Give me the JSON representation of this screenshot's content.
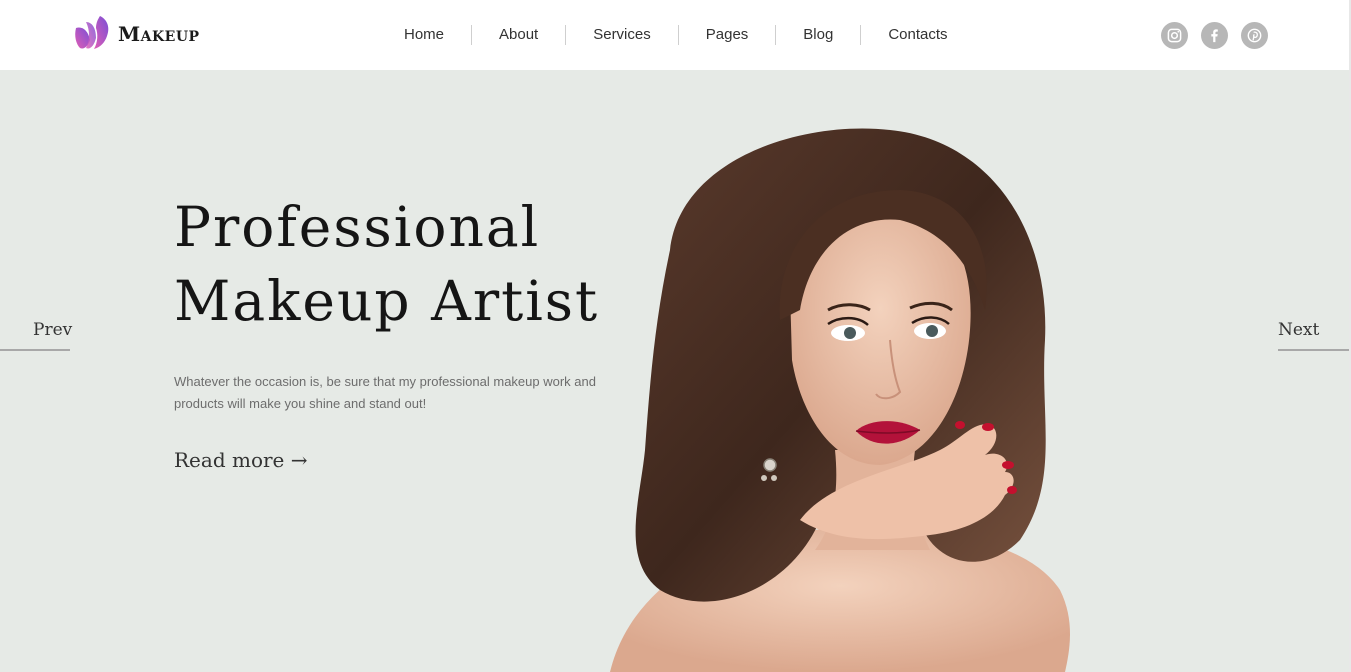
{
  "brand": {
    "name": "Makeup",
    "icon": "butterfly-face-logo"
  },
  "nav": {
    "items": [
      {
        "label": "Home"
      },
      {
        "label": "About"
      },
      {
        "label": "Services"
      },
      {
        "label": "Pages"
      },
      {
        "label": "Blog"
      },
      {
        "label": "Contacts"
      }
    ]
  },
  "social": [
    {
      "icon": "instagram-icon"
    },
    {
      "icon": "facebook-icon"
    },
    {
      "icon": "pinterest-icon"
    }
  ],
  "hero": {
    "title_line1": "Professional",
    "title_line2": "Makeup Artist",
    "description": "Whatever the occasion is, be sure that my professional makeup work and products will make you shine and stand out!",
    "read_more": "Read more →",
    "prev_label": "Prev",
    "next_label": "Next"
  },
  "colors": {
    "hero_bg": "#e6eae6",
    "logo_gradient": [
      "#7a4fd6",
      "#e05db5"
    ],
    "social_bg": "#b7b7b7",
    "lipstick": "#b3123a"
  }
}
